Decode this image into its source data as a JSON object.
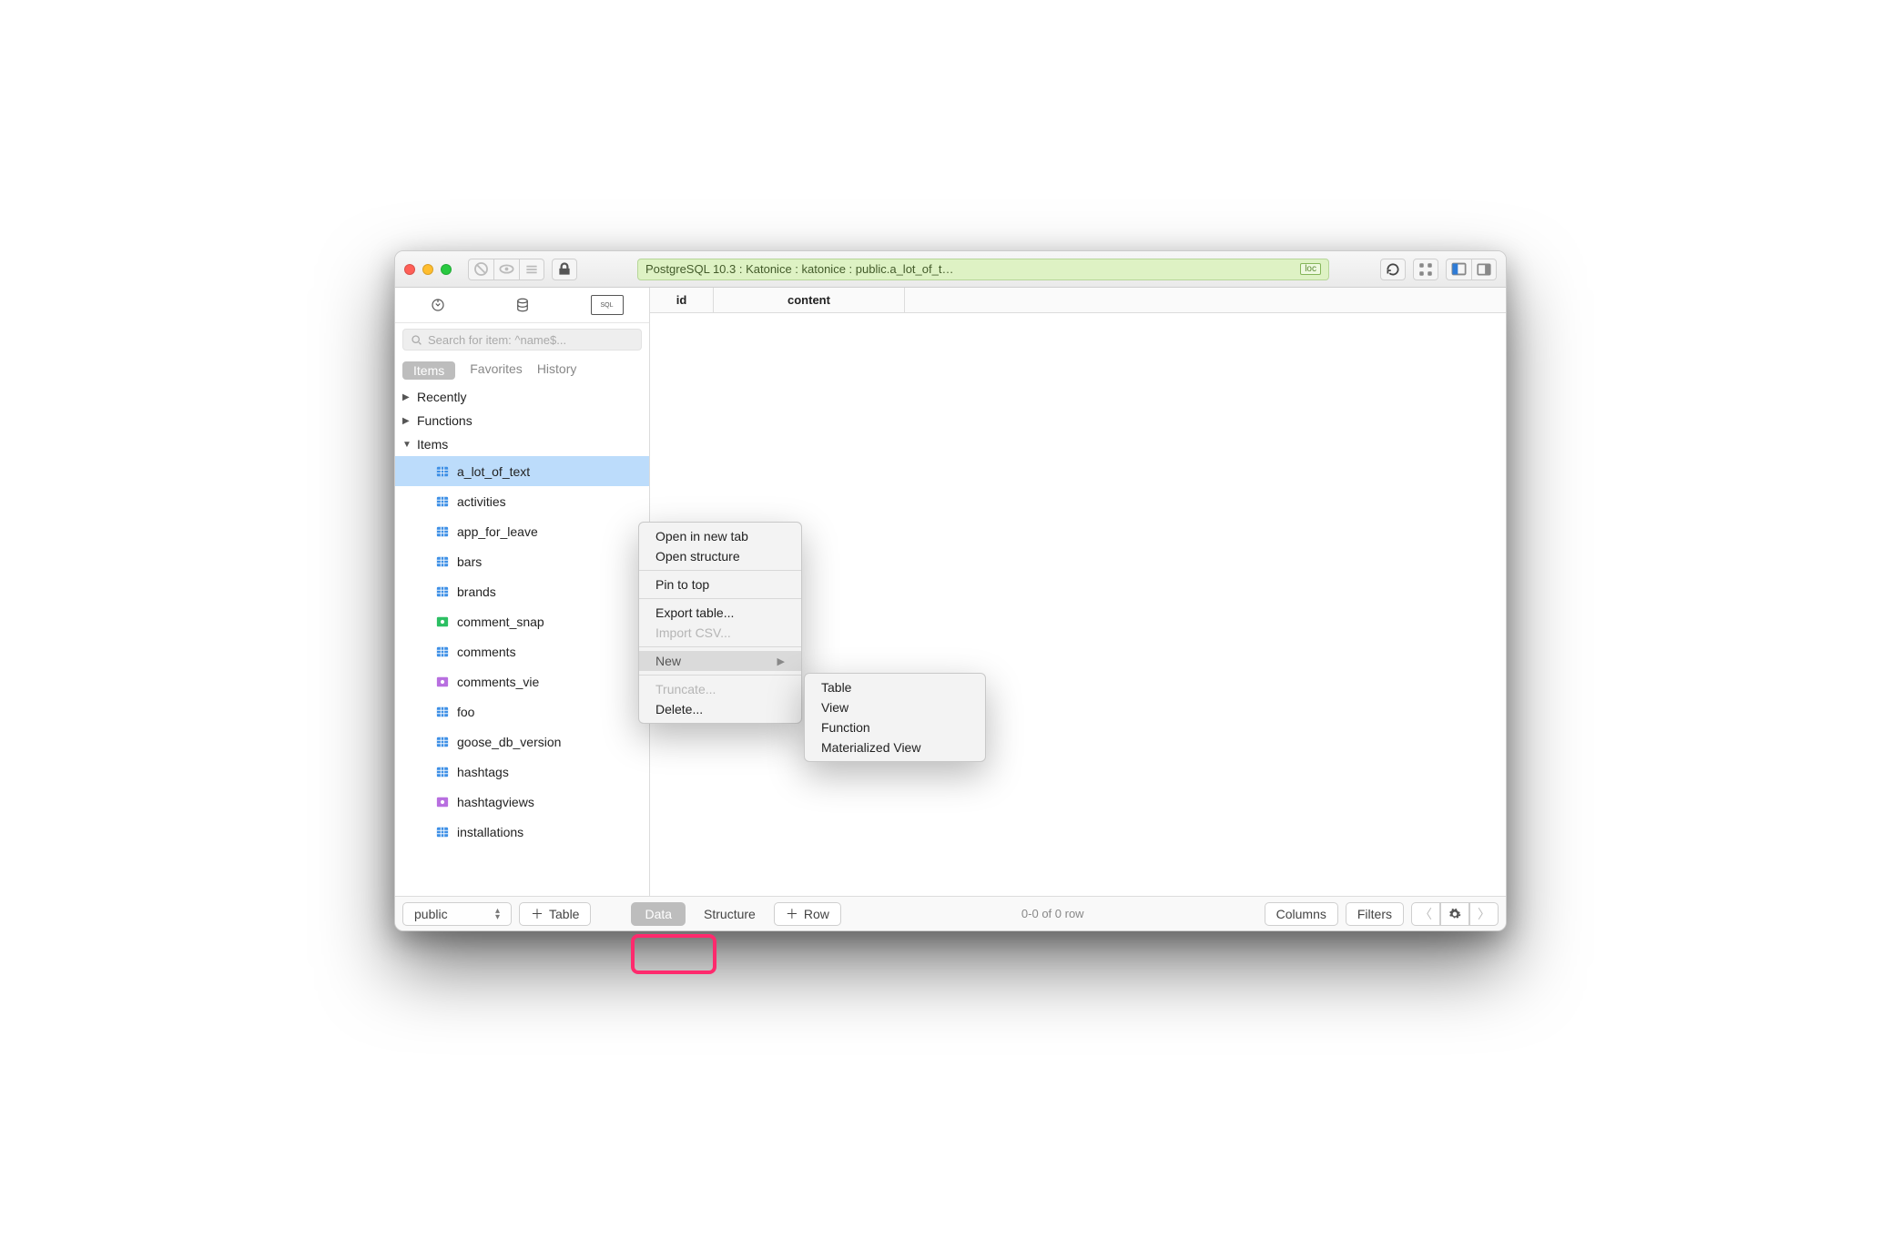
{
  "pathbar": {
    "text": "PostgreSQL 10.3 : Katonice : katonice : public.a_lot_of_t…",
    "loc_label": "loc"
  },
  "search": {
    "placeholder": "Search for item: ^name$..."
  },
  "tabs": {
    "items": "Items",
    "favorites": "Favorites",
    "history": "History"
  },
  "tree": {
    "recently": "Recently",
    "functions": "Functions",
    "items": "Items",
    "tables": [
      {
        "name": "a_lot_of_text",
        "kind": "table",
        "selected": true
      },
      {
        "name": "activities",
        "kind": "table"
      },
      {
        "name": "app_for_leave",
        "kind": "table"
      },
      {
        "name": "bars",
        "kind": "table"
      },
      {
        "name": "brands",
        "kind": "table"
      },
      {
        "name": "comment_snap",
        "kind": "view-green"
      },
      {
        "name": "comments",
        "kind": "table"
      },
      {
        "name": "comments_vie",
        "kind": "view-purple"
      },
      {
        "name": "foo",
        "kind": "table"
      },
      {
        "name": "goose_db_version",
        "kind": "table"
      },
      {
        "name": "hashtags",
        "kind": "table"
      },
      {
        "name": "hashtagviews",
        "kind": "view-purple"
      },
      {
        "name": "installations",
        "kind": "table"
      }
    ]
  },
  "columns": {
    "id": "id",
    "content": "content"
  },
  "bottom": {
    "schema": "public",
    "add_table": "Table",
    "data": "Data",
    "structure": "Structure",
    "row": "Row",
    "status": "0-0 of 0 row",
    "columns_btn": "Columns",
    "filters_btn": "Filters"
  },
  "ctx1": {
    "open_tab": "Open in new tab",
    "open_struct": "Open structure",
    "pin": "Pin to top",
    "export": "Export table...",
    "import": "Import CSV...",
    "new": "New",
    "truncate": "Truncate...",
    "delete": "Delete..."
  },
  "ctx2": {
    "table": "Table",
    "view": "View",
    "function": "Function",
    "matview": "Materialized View"
  }
}
